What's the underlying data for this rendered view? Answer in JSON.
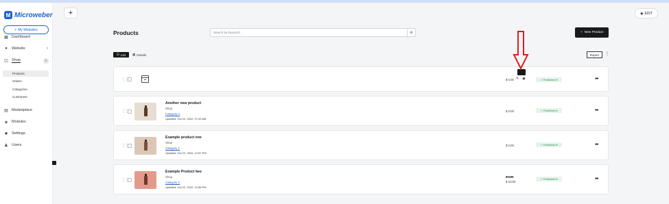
{
  "brand": {
    "name": "Microweber",
    "logo_glyph": "M"
  },
  "sidebar": {
    "my_websites": "My Websites",
    "items": [
      {
        "label": "Dashboard",
        "icon": "dashboard-icon"
      },
      {
        "label": "Website",
        "icon": "globe-icon"
      },
      {
        "label": "Shop",
        "icon": "shop-icon"
      },
      {
        "label": "Marketplace",
        "icon": "marketplace-icon"
      },
      {
        "label": "Modules",
        "icon": "modules-icon"
      },
      {
        "label": "Settings",
        "icon": "gear-icon"
      },
      {
        "label": "Users",
        "icon": "users-icon"
      }
    ],
    "shop_sub": [
      "Products",
      "Orders",
      "Categories",
      "Customers"
    ]
  },
  "toolbar": {
    "add": "+",
    "edit": "EDIT"
  },
  "page": {
    "title": "Products",
    "search_placeholder": "Search by keyword...",
    "new_product": "New Product",
    "view_list": "List",
    "view_details": "Details",
    "export": "Export"
  },
  "rows": [
    {
      "title": "",
      "shop": "",
      "category": "",
      "updated": "",
      "price": "$ 0.00",
      "status": "Published"
    },
    {
      "title": "Another new product",
      "shop": "Shop",
      "category": "Category 2",
      "updated": "Updated: Oct 24, 2022, 07:43 AM",
      "price": "$ 0.00",
      "status": "Published"
    },
    {
      "title": "Example product one",
      "shop": "Shop",
      "category": "Category 1",
      "updated": "Updated: Oct 22, 2022, 12:57 PM",
      "price": "$ 0.00",
      "status": "Published"
    },
    {
      "title": "Example Product two",
      "shop": "Shop",
      "category": "Category 2",
      "updated": "Updated: Oct 22, 2022, 12:58 PM",
      "price_old": "$ 0.00",
      "price": "$ 10.00",
      "status": "Published"
    }
  ],
  "colors": {
    "accent": "#1f63c6",
    "status_bg": "#e5f4ea",
    "status_text": "#2e8b4f",
    "annotation_arrow": "#e01b1b"
  }
}
